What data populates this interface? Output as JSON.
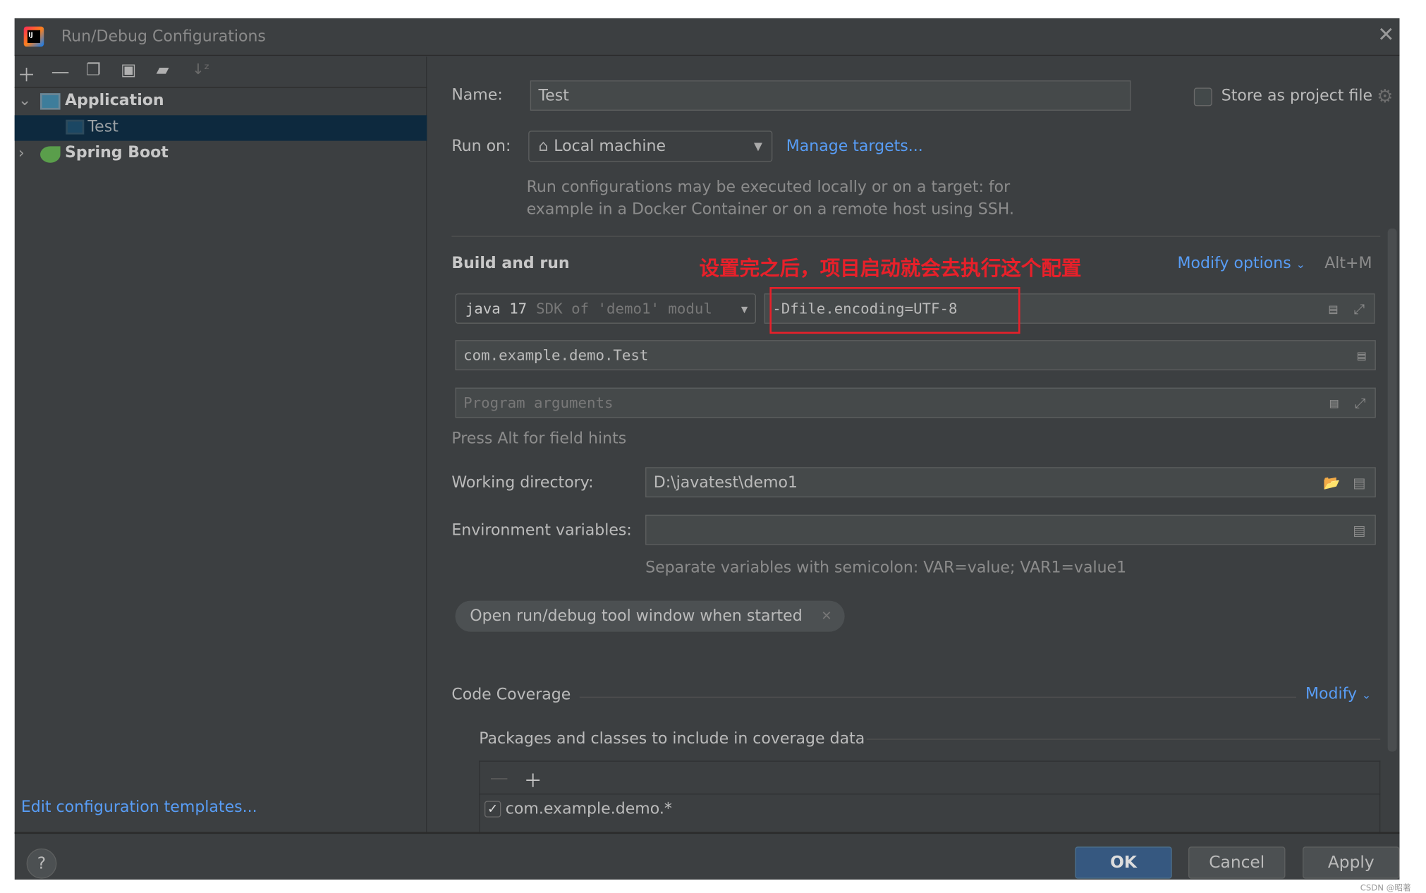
{
  "window": {
    "title": "Run/Debug Configurations"
  },
  "toolbar": {
    "icons": [
      "plus-icon",
      "minus-icon",
      "copy-icon",
      "save-icon",
      "new-folder-icon",
      "sort-icon"
    ]
  },
  "tree": {
    "items": [
      {
        "label": "Application",
        "expanded": true
      },
      {
        "label": "Test",
        "selected": true
      },
      {
        "label": "Spring Boot",
        "expanded": false
      }
    ]
  },
  "left": {
    "edit_templates": "Edit configuration templates..."
  },
  "form": {
    "name_label": "Name:",
    "name_value": "Test",
    "store_label": "Store as project file",
    "store_checked": false,
    "run_on_label": "Run on:",
    "run_on_value": "Local machine",
    "manage_targets": "Manage targets...",
    "run_desc_1": "Run configurations may be executed locally or on a target: for",
    "run_desc_2": "example in a Docker Container or on a remote host using SSH.",
    "build_run": "Build and run",
    "annotation": "设置完之后，项目启动就会去执行这个配置",
    "modify_options": "Modify options",
    "modify_shortcut": "Alt+M",
    "jre_main": "java 17",
    "jre_sub": "SDK of 'demo1' modul",
    "vm_options": "-Dfile.encoding=UTF-8",
    "main_class": "com.example.demo.Test",
    "program_args_placeholder": "Program arguments",
    "alt_hint": "Press Alt for field hints",
    "workdir_label": "Working directory:",
    "workdir_value": "D:\\javatest\\demo1",
    "env_label": "Environment variables:",
    "env_value": "",
    "env_hint": "Separate variables with semicolon: VAR=value; VAR1=value1",
    "chip": "Open run/debug tool window when started",
    "coverage": "Code Coverage",
    "coverage_modify": "Modify",
    "packages_label": "Packages and classes to include in coverage data",
    "packages": [
      {
        "label": "com.example.demo.*",
        "checked": true
      }
    ]
  },
  "buttons": {
    "ok": "OK",
    "cancel": "Cancel",
    "apply": "Apply",
    "help": "?"
  },
  "watermark": "CSDN @昭著",
  "colors": {
    "bg": "#3c3f41",
    "accent": "#589df6",
    "selection": "#0d293e",
    "ok": "#365880",
    "annotation": "#e8202a"
  }
}
